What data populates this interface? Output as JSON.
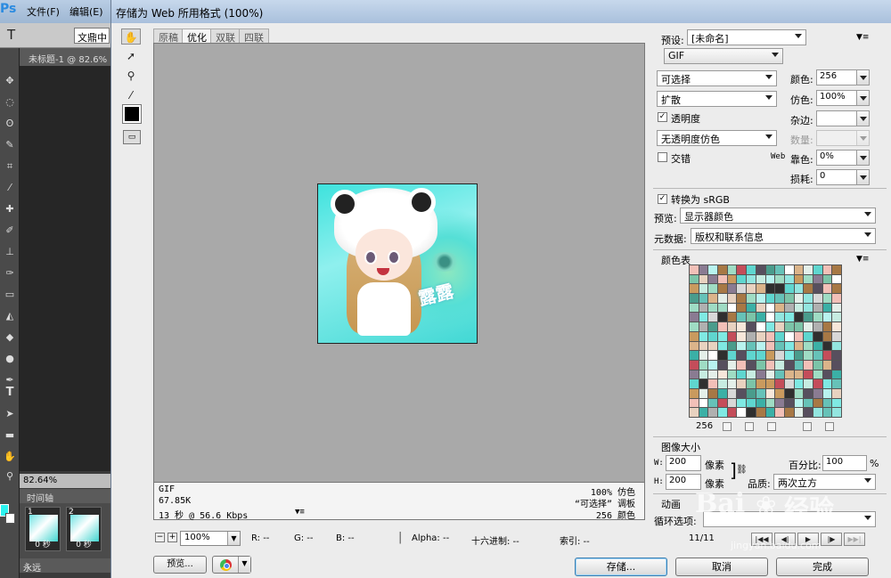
{
  "ps": {
    "logo": "Ps",
    "menu": [
      "文件(F)",
      "编辑(E)"
    ],
    "tool_letter": "T",
    "font_field": "文鼎中",
    "doc_tab": "未标题-1 @ 82.6%",
    "zoom": "82.64%",
    "timeline_title": "时间轴",
    "frames": [
      {
        "num": "1",
        "delay": "0 秒"
      },
      {
        "num": "2",
        "delay": "0 秒"
      }
    ],
    "loop": "永远"
  },
  "dialog": {
    "title": "存储为 Web 所用格式 (100%)",
    "tabs": [
      "原稿",
      "优化",
      "双联",
      "四联"
    ],
    "active_tab": 1,
    "preview_text": "露露",
    "info": {
      "format": "GIF",
      "size": "67.85K",
      "time": "13 秒 @ 56.6 Kbps",
      "dither": "100% 仿色",
      "palette": "“可选择” 调板",
      "colors": "256 颜色"
    },
    "status": {
      "zoom": "100%",
      "r": "R: --",
      "g": "G: --",
      "b": "B: --",
      "alpha": "Alpha: --",
      "hex": "十六进制: --",
      "index": "索引: --"
    },
    "buttons": {
      "preview": "预览...",
      "save": "存储...",
      "cancel": "取消",
      "done": "完成"
    }
  },
  "settings": {
    "preset_label": "预设:",
    "preset_value": "[未命名]",
    "format": "GIF",
    "palette": "可选择",
    "dither_algo": "扩散",
    "transparency_label": "透明度",
    "transparency_checked": true,
    "trans_dither": "无透明度仿色",
    "interlaced_label": "交错",
    "interlaced_checked": false,
    "colors_label": "颜色:",
    "colors_value": "256",
    "dither_label": "仿色:",
    "dither_value": "100%",
    "matte_label": "杂边:",
    "matte_value": "",
    "amount_label": "数量:",
    "amount_value": "",
    "web_snap_prefix": "Web",
    "web_snap_label": "靠色:",
    "web_snap_value": "0%",
    "lossy_label": "损耗:",
    "lossy_value": "0",
    "srgb_label": "转换为 sRGB",
    "srgb_checked": true,
    "preview_label": "预览:",
    "preview_value": "显示器颜色",
    "metadata_label": "元数据:",
    "metadata_value": "版权和联系信息",
    "color_table_title": "颜色表",
    "color_count": "256",
    "image_size_title": "图像大小",
    "w_label": "W:",
    "w_value": "200",
    "h_label": "H:",
    "h_value": "200",
    "px_unit": "像素",
    "percent_label": "百分比:",
    "percent_value": "100",
    "percent_unit": "%",
    "quality_label": "品质:",
    "quality_value": "两次立方",
    "animation_title": "动画",
    "loop_label": "循环选项:",
    "frame_counter": "11/11"
  },
  "watermark": {
    "main": "Bai",
    "paw": "❀",
    "cn": "经验",
    "url": "jingyan.baidu.com"
  },
  "colors": {
    "accent": "#3c7fb1",
    "preview_bg": "#a9a9a9",
    "swatch_fg": "#2cf3f0"
  }
}
